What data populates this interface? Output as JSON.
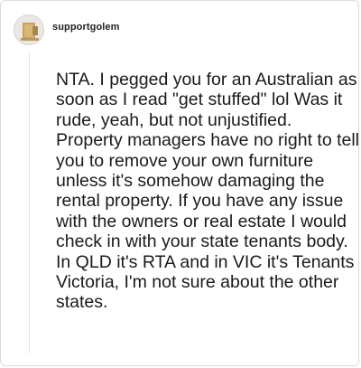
{
  "comment": {
    "author": "supportgolem",
    "body": "NTA. I pegged you for an Australian as soon as I read \"get stuffed\" lol Was it rude, yeah, but not unjustified. Property managers have no right to tell you to remove your own furniture unless it's somehow damaging the rental property. If you have any issue with the owners or real estate I would check in with your state tenants body. In QLD it's RTA and in VIC it's Tenants Victoria, I'm not sure about the other states."
  },
  "icons": {
    "avatar": "user-avatar-icon"
  }
}
